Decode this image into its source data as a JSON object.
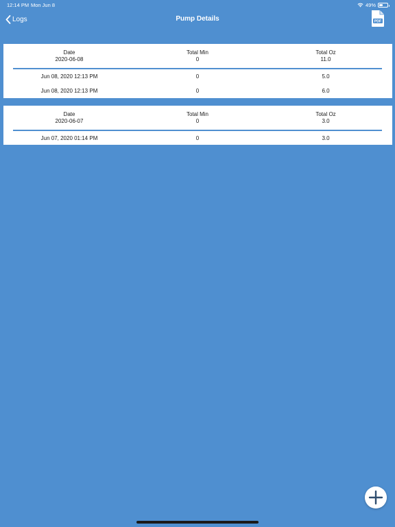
{
  "status_bar": {
    "time": "12:14 PM",
    "date": "Mon Jun 8",
    "battery": "49%",
    "battery_level": 0.49
  },
  "nav": {
    "back_label": "Logs",
    "title": "Pump Details",
    "pdf_label": "PDF"
  },
  "groups": [
    {
      "header": {
        "date_label": "Date",
        "date_value": "2020-06-08",
        "min_label": "Total Min",
        "min_value": "0",
        "oz_label": "Total Oz",
        "oz_value": "11.0"
      },
      "rows": [
        {
          "date": "Jun 08, 2020 12:13 PM",
          "min": "0",
          "oz": "5.0"
        },
        {
          "date": "Jun 08, 2020 12:13 PM",
          "min": "0",
          "oz": "6.0"
        }
      ]
    },
    {
      "header": {
        "date_label": "Date",
        "date_value": "2020-06-07",
        "min_label": "Total Min",
        "min_value": "0",
        "oz_label": "Total Oz",
        "oz_value": "3.0"
      },
      "rows": [
        {
          "date": "Jun 07, 2020 01:14 PM",
          "min": "0",
          "oz": "3.0"
        }
      ]
    }
  ],
  "colors": {
    "background": "#4f8fd0",
    "card": "#ffffff",
    "accent": "#4f8fd0",
    "text": "#1a1a1a"
  },
  "icons": {
    "back": "chevron-left-icon",
    "pdf": "pdf-document-icon",
    "add": "plus-icon",
    "wifi": "wifi-icon",
    "battery": "battery-icon"
  }
}
